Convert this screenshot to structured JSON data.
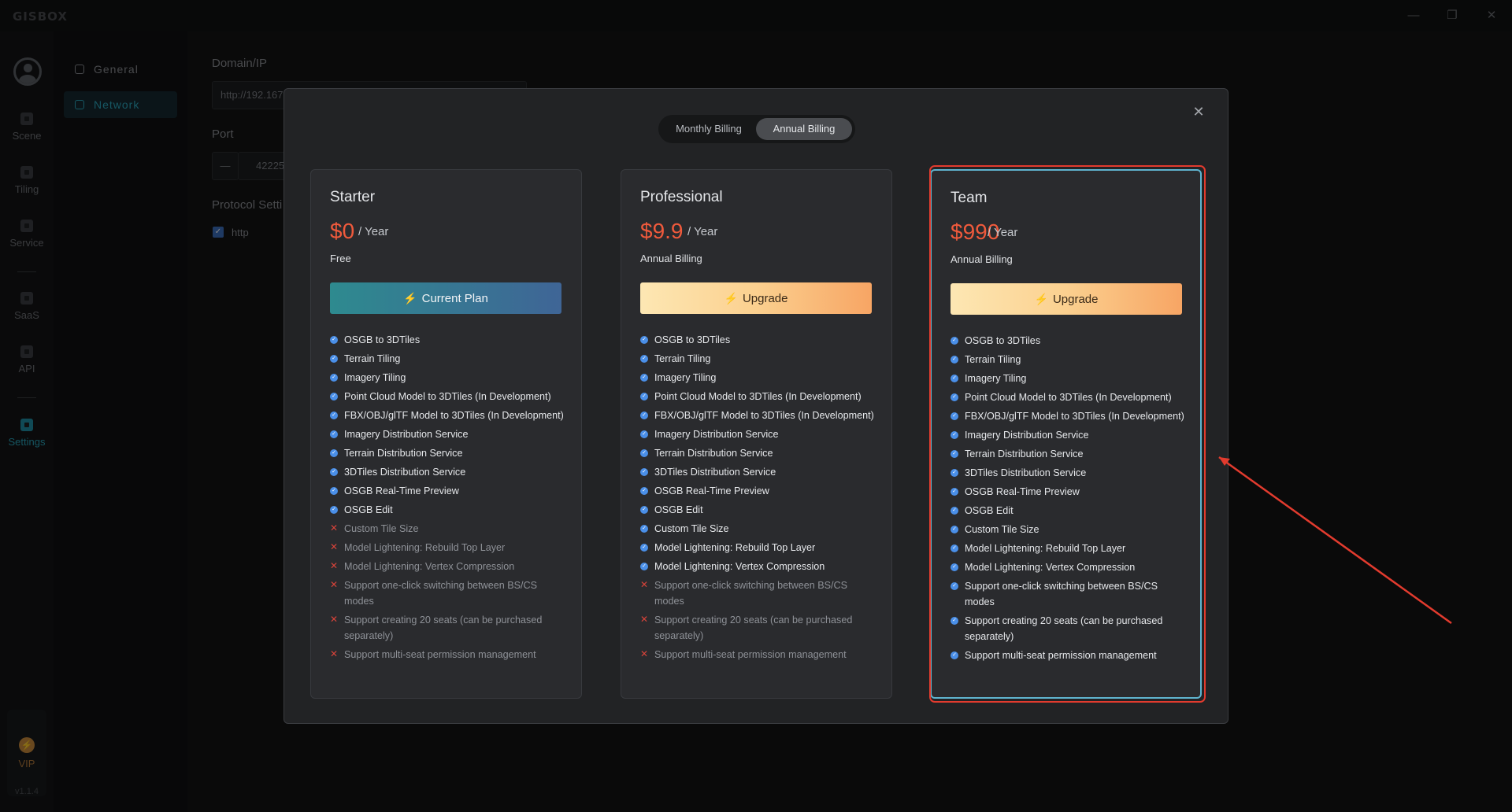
{
  "app": {
    "logo": "GISBOX",
    "version": "v1.1.4"
  },
  "window_controls": {
    "minimize": "—",
    "restore": "❐",
    "close": "✕"
  },
  "leftnav": {
    "items": [
      {
        "label": "Scene",
        "icon": "scene-icon"
      },
      {
        "label": "Tiling",
        "icon": "tiling-icon"
      },
      {
        "label": "Service",
        "icon": "service-icon"
      },
      {
        "label": "SaaS",
        "icon": "saas-icon"
      },
      {
        "label": "API",
        "icon": "api-icon"
      },
      {
        "label": "Settings",
        "icon": "settings-icon",
        "active": true
      }
    ],
    "vip_label": "VIP",
    "vip_icon": "⚡"
  },
  "subnav": {
    "items": [
      {
        "label": "General"
      },
      {
        "label": "Network",
        "active": true
      }
    ]
  },
  "settings": {
    "domain_label": "Domain/IP",
    "domain_value": "http://192.167.",
    "port_label": "Port",
    "port_minus": "—",
    "port_value": "42225",
    "protocol_label": "Protocol Setti",
    "protocol_option": "http"
  },
  "modal": {
    "close": "✕",
    "billing": {
      "monthly": "Monthly Billing",
      "annual": "Annual Billing",
      "selected": "annual"
    },
    "plans": [
      {
        "name": "Starter",
        "price": "$0",
        "period": "/ Year",
        "note": "Free",
        "button": "Current Plan",
        "button_type": "current",
        "features": [
          {
            "text": "OSGB to 3DTiles",
            "included": true
          },
          {
            "text": "Terrain Tiling",
            "included": true
          },
          {
            "text": "Imagery Tiling",
            "included": true
          },
          {
            "text": "Point Cloud Model to 3DTiles (In Development)",
            "included": true
          },
          {
            "text": "FBX/OBJ/glTF Model to 3DTiles (In Development)",
            "included": true
          },
          {
            "text": "Imagery Distribution Service",
            "included": true
          },
          {
            "text": "Terrain Distribution Service",
            "included": true
          },
          {
            "text": "3DTiles Distribution Service",
            "included": true
          },
          {
            "text": "OSGB Real-Time Preview",
            "included": true
          },
          {
            "text": "OSGB Edit",
            "included": true
          },
          {
            "text": "Custom Tile Size",
            "included": false
          },
          {
            "text": "Model Lightening: Rebuild Top Layer",
            "included": false
          },
          {
            "text": "Model Lightening: Vertex Compression",
            "included": false
          },
          {
            "text": "Support one-click switching between BS/CS modes",
            "included": false
          },
          {
            "text": "Support creating 20 seats (can be purchased separately)",
            "included": false
          },
          {
            "text": "Support multi-seat permission management",
            "included": false
          }
        ]
      },
      {
        "name": "Professional",
        "price": "$9.9",
        "period": "/ Year",
        "note": "Annual Billing",
        "button": "Upgrade",
        "button_type": "upgrade",
        "features": [
          {
            "text": "OSGB to 3DTiles",
            "included": true
          },
          {
            "text": "Terrain Tiling",
            "included": true
          },
          {
            "text": "Imagery Tiling",
            "included": true
          },
          {
            "text": "Point Cloud Model to 3DTiles (In Development)",
            "included": true
          },
          {
            "text": "FBX/OBJ/glTF Model to 3DTiles (In Development)",
            "included": true
          },
          {
            "text": "Imagery Distribution Service",
            "included": true
          },
          {
            "text": "Terrain Distribution Service",
            "included": true
          },
          {
            "text": "3DTiles Distribution Service",
            "included": true
          },
          {
            "text": "OSGB Real-Time Preview",
            "included": true
          },
          {
            "text": "OSGB Edit",
            "included": true
          },
          {
            "text": "Custom Tile Size",
            "included": true
          },
          {
            "text": "Model Lightening: Rebuild Top Layer",
            "included": true
          },
          {
            "text": "Model Lightening: Vertex Compression",
            "included": true
          },
          {
            "text": "Support one-click switching between BS/CS modes",
            "included": false
          },
          {
            "text": "Support creating 20 seats (can be purchased separately)",
            "included": false
          },
          {
            "text": "Support multi-seat permission management",
            "included": false
          }
        ]
      },
      {
        "name": "Team",
        "price": "$990",
        "period": "/ Year",
        "note": "Annual Billing",
        "button": "Upgrade",
        "button_type": "upgrade",
        "highlight": true,
        "features": [
          {
            "text": "OSGB to 3DTiles",
            "included": true
          },
          {
            "text": "Terrain Tiling",
            "included": true
          },
          {
            "text": "Imagery Tiling",
            "included": true
          },
          {
            "text": "Point Cloud Model to 3DTiles (In Development)",
            "included": true
          },
          {
            "text": "FBX/OBJ/glTF Model to 3DTiles (In Development)",
            "included": true
          },
          {
            "text": "Imagery Distribution Service",
            "included": true
          },
          {
            "text": "Terrain Distribution Service",
            "included": true
          },
          {
            "text": "3DTiles Distribution Service",
            "included": true
          },
          {
            "text": "OSGB Real-Time Preview",
            "included": true
          },
          {
            "text": "OSGB Edit",
            "included": true
          },
          {
            "text": "Custom Tile Size",
            "included": true
          },
          {
            "text": "Model Lightening: Rebuild Top Layer",
            "included": true
          },
          {
            "text": "Model Lightening: Vertex Compression",
            "included": true
          },
          {
            "text": "Support one-click switching between BS/CS modes",
            "included": true
          },
          {
            "text": "Support creating 20 seats (can be purchased separately)",
            "included": true
          },
          {
            "text": "Support multi-seat permission management",
            "included": true
          }
        ]
      }
    ]
  },
  "colors": {
    "accent": "#2aa4bb",
    "price": "#f05a3c",
    "annotation": "#e23b2e",
    "check": "#4a8fe8"
  }
}
